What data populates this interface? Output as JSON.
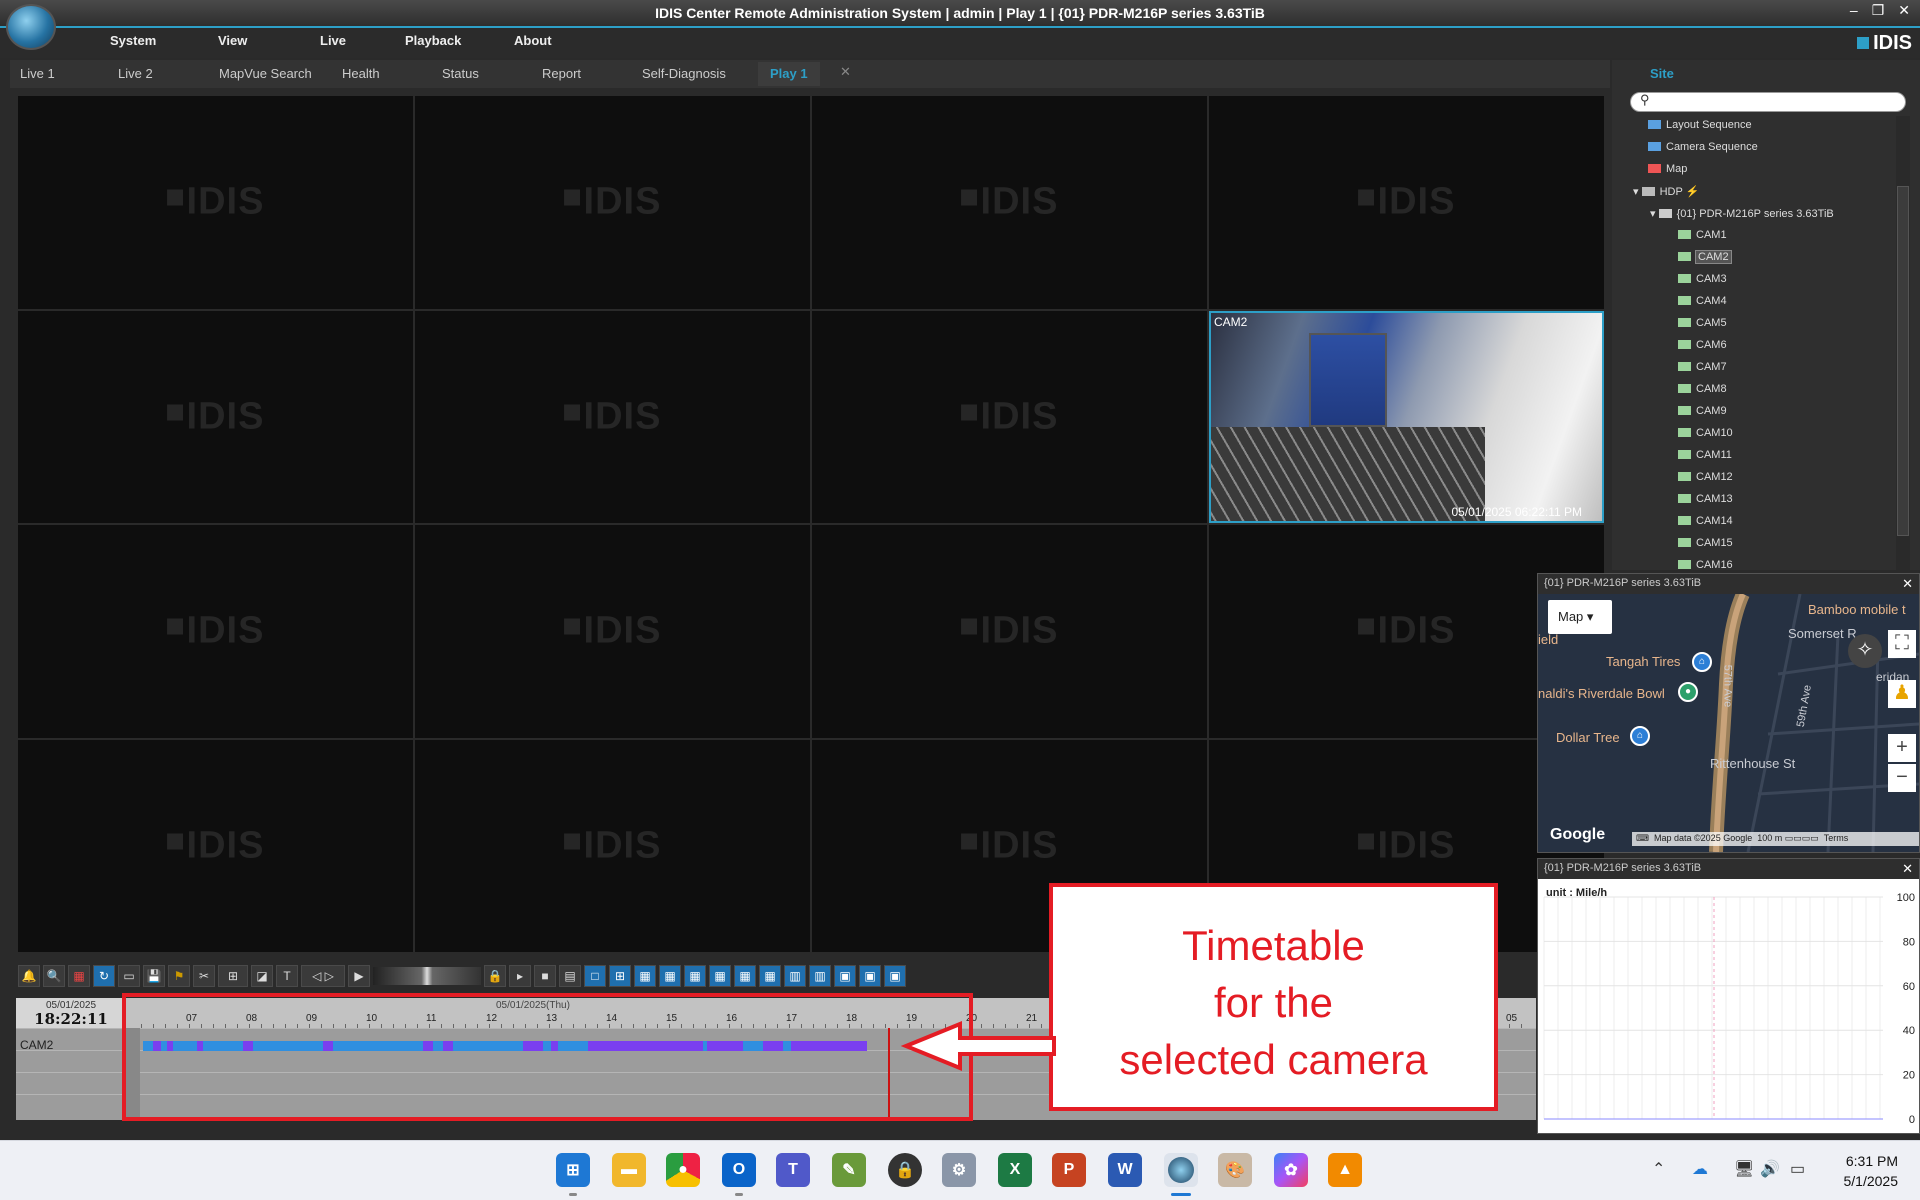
{
  "window": {
    "title": "IDIS Center Remote Administration System | admin | Play 1 | {01} PDR-M216P series 3.63TiB",
    "brand": "IDIS"
  },
  "menu": [
    "System",
    "View",
    "Live",
    "Playback",
    "About"
  ],
  "tabs": [
    "Live 1",
    "Live 2",
    "MapVue Search",
    "Health",
    "Status",
    "Report",
    "Self-Diagnosis",
    "Play 1"
  ],
  "active_tab": "Play 1",
  "grid": {
    "watermark": "IDIS",
    "camera_tile": {
      "label": "CAM2",
      "timestamp": "05/01/2025 06:22:11 PM"
    }
  },
  "timeline": {
    "date": "05/01/2025",
    "time": "18:22:11",
    "day_label": "05/01/2025(Thu)",
    "hours": [
      "07",
      "08",
      "09",
      "10",
      "11",
      "12",
      "13",
      "14",
      "15",
      "16",
      "17",
      "18",
      "19",
      "20",
      "21",
      "05"
    ],
    "camera_row": "CAM2"
  },
  "callout": {
    "line1": "Timetable",
    "line2": "for the",
    "line3": "selected camera"
  },
  "site": {
    "title": "Site",
    "search_placeholder": "",
    "items": [
      "Layout Sequence",
      "Camera Sequence",
      "Map",
      "HDP",
      "{01} PDR-M216P series 3.63TiB"
    ],
    "cameras": [
      "CAM1",
      "CAM2",
      "CAM3",
      "CAM4",
      "CAM5",
      "CAM6",
      "CAM7",
      "CAM8",
      "CAM9",
      "CAM10",
      "CAM11",
      "CAM12",
      "CAM13",
      "CAM14",
      "CAM15",
      "CAM16"
    ],
    "selected_camera": "CAM2"
  },
  "map_panel": {
    "title": "{01} PDR-M216P series 3.63TiB",
    "type_select": "Map",
    "labels": {
      "bamboo": "Bamboo mobile t",
      "somerset": "Somerset R",
      "field": "ield",
      "tangah": "Tangah Tires",
      "riverdale": "naldi's Riverdale Bowl",
      "dollar": "Dollar Tree",
      "rittenhouse": "Rittenhouse St",
      "ave57": "57th Ave",
      "ave59": "59th Ave",
      "sheridan": "eridan"
    },
    "google": "Google",
    "footer": {
      "data": "Map data ©2025 Google",
      "scale": "100 m",
      "terms": "Terms"
    }
  },
  "chart_panel": {
    "title": "{01} PDR-M216P series 3.63TiB",
    "unit": "unit : Mile/h"
  },
  "chart_data": {
    "type": "line",
    "title": "",
    "ylabel": "unit : Mile/h",
    "ylim": [
      0,
      100
    ],
    "yticks": [
      0,
      20,
      40,
      60,
      80,
      100
    ],
    "series": [
      {
        "values": []
      }
    ],
    "grid": true
  },
  "taskbar": {
    "time": "6:31 PM",
    "date": "5/1/2025"
  },
  "colors": {
    "accent": "#2d9fc7",
    "callout_red": "#e41c24",
    "rec_purple": "#7a3ff0",
    "rec_blue": "#2f8fe0"
  }
}
